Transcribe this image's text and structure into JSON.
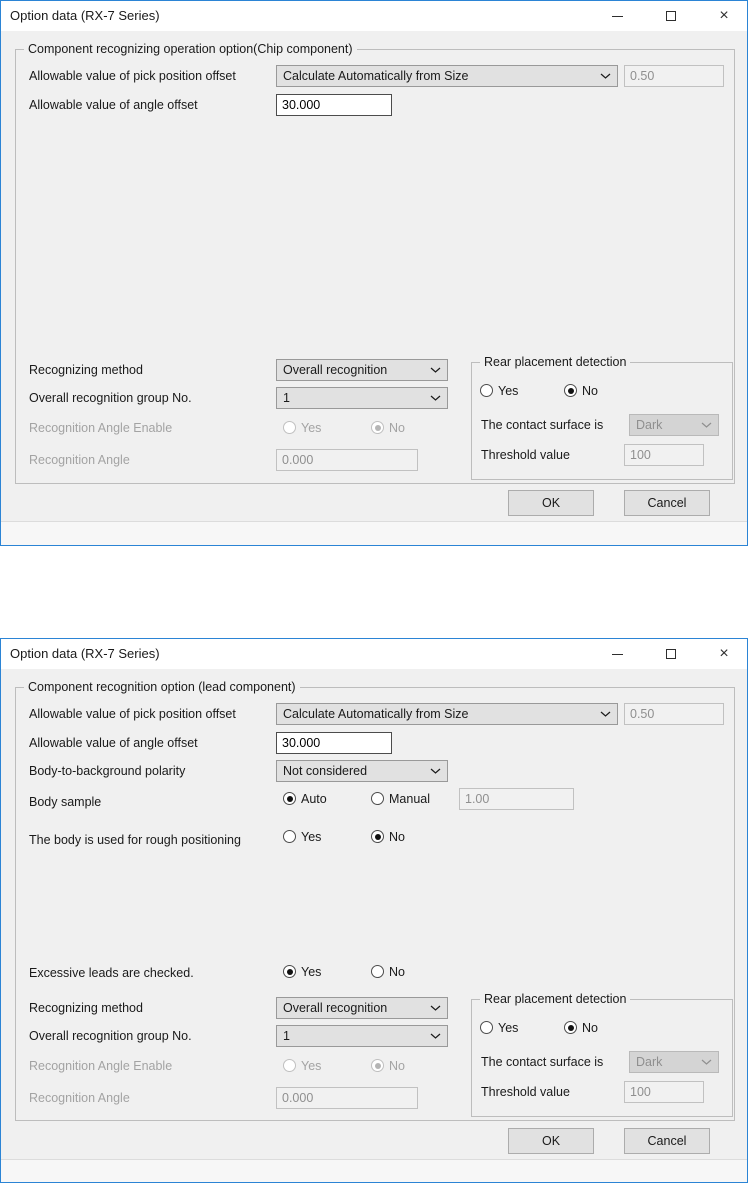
{
  "window": {
    "title": "Option data (RX-7 Series)"
  },
  "icons": {
    "minimize": "minimize-bar",
    "maximize": "square-outline",
    "close": "×",
    "combo_chevron": "chevron-down"
  },
  "common": {
    "yes": "Yes",
    "no": "No",
    "ok": "OK",
    "cancel": "Cancel"
  },
  "dialog1": {
    "group_title": "Component recognizing operation option(Chip component)",
    "pick_offset": {
      "label": "Allowable value of pick position offset",
      "value": "Calculate Automatically from Size",
      "aux_value": "0.50"
    },
    "angle_offset": {
      "label": "Allowable value of angle offset",
      "value": "30.000"
    },
    "method": {
      "label": "Recognizing method",
      "value": "Overall recognition"
    },
    "group_no": {
      "label": "Overall recognition group No.",
      "value": "1"
    },
    "angle_enable": {
      "label": "Recognition Angle Enable",
      "selected": "No",
      "enabled": false
    },
    "recognition_angle": {
      "label": "Recognition Angle",
      "value": "0.000",
      "enabled": false
    },
    "rear": {
      "title": "Rear placement detection",
      "selected": "No",
      "contact": {
        "label": "The contact surface is",
        "value": "Dark",
        "enabled": false
      },
      "threshold": {
        "label": "Threshold value",
        "value": "100",
        "enabled": false
      }
    }
  },
  "dialog2": {
    "group_title": "Component recognition option (lead component)",
    "pick_offset": {
      "label": "Allowable value of pick position offset",
      "value": "Calculate Automatically from Size",
      "aux_value": "0.50"
    },
    "angle_offset": {
      "label": "Allowable value of angle offset",
      "value": "30.000"
    },
    "polarity": {
      "label": "Body-to-background polarity",
      "value": "Not considered"
    },
    "body_sample": {
      "label": "Body sample",
      "auto_label": "Auto",
      "manual_label": "Manual",
      "selected": "Auto",
      "value": "1.00"
    },
    "rough_positioning": {
      "label": "The body is used for rough positioning",
      "selected": "No"
    },
    "excessive_leads": {
      "label": "Excessive leads are checked.",
      "selected": "Yes"
    },
    "method": {
      "label": "Recognizing method",
      "value": "Overall recognition"
    },
    "group_no": {
      "label": "Overall recognition group No.",
      "value": "1"
    },
    "angle_enable": {
      "label": "Recognition Angle Enable",
      "selected": "No",
      "enabled": false
    },
    "recognition_angle": {
      "label": "Recognition Angle",
      "value": "0.000",
      "enabled": false
    },
    "rear": {
      "title": "Rear placement detection",
      "selected": "No",
      "contact": {
        "label": "The contact surface is",
        "value": "Dark",
        "enabled": false
      },
      "threshold": {
        "label": "Threshold value",
        "value": "100",
        "enabled": false
      }
    }
  }
}
